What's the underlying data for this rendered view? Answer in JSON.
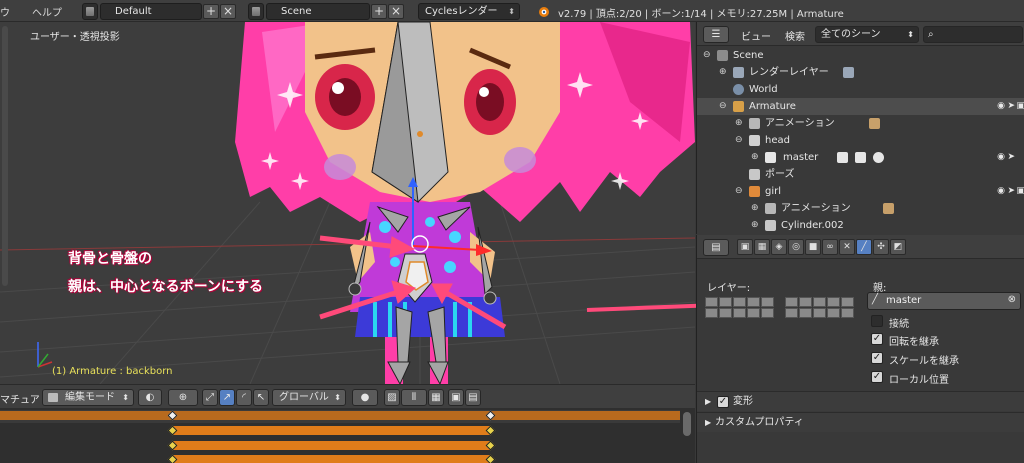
{
  "topbar": {
    "menu_window": "ウ",
    "menu_help": "ヘルプ",
    "screen_layout": "Default",
    "scene": "Scene",
    "render_engine": "Cyclesレンダー",
    "stats": "v2.79 | 頂点:2/20 | ボーン:1/14 | メモリ:27.25M | Armature"
  },
  "viewport": {
    "view_label": "ユーザー・透視投影",
    "selection_label": "(1) Armature : backborn",
    "annotation_line1": "背骨と骨盤の",
    "annotation_line2": "親は、中心となるボーンにする"
  },
  "vp_header": {
    "editor_label": "マチュア",
    "mode": "編集モード",
    "orientation": "グローバル"
  },
  "outliner": {
    "view_menu": "ビュー",
    "search_menu": "検索",
    "scene_filter": "全てのシーン",
    "rows": [
      {
        "label": "Scene"
      },
      {
        "label": "レンダーレイヤー"
      },
      {
        "label": "World"
      },
      {
        "label": "Armature"
      },
      {
        "label": "アニメーション"
      },
      {
        "label": "head"
      },
      {
        "label": "master"
      },
      {
        "label": "ポーズ"
      },
      {
        "label": "girl"
      },
      {
        "label": "アニメーション"
      },
      {
        "label": "Cylinder.002"
      }
    ]
  },
  "properties": {
    "layer_label": "レイヤー:",
    "parent_label": "親:",
    "parent_value": "master",
    "connected_label": "接続",
    "inherit_rotation_label": "回転を継承",
    "inherit_scale_label": "スケールを継承",
    "local_location_label": "ローカル位置",
    "panel_transform": "変形",
    "panel_custom_props": "カスタムプロパティ",
    "connected": false,
    "inherit_rotation": true,
    "inherit_scale": true,
    "local_location": true
  },
  "colors": {
    "accent_blue": "#5680c2",
    "timeline_orange": "#e07c1a",
    "annotation_arrow": "#ff4a7a",
    "selection_yellow": "#e8e05a"
  }
}
